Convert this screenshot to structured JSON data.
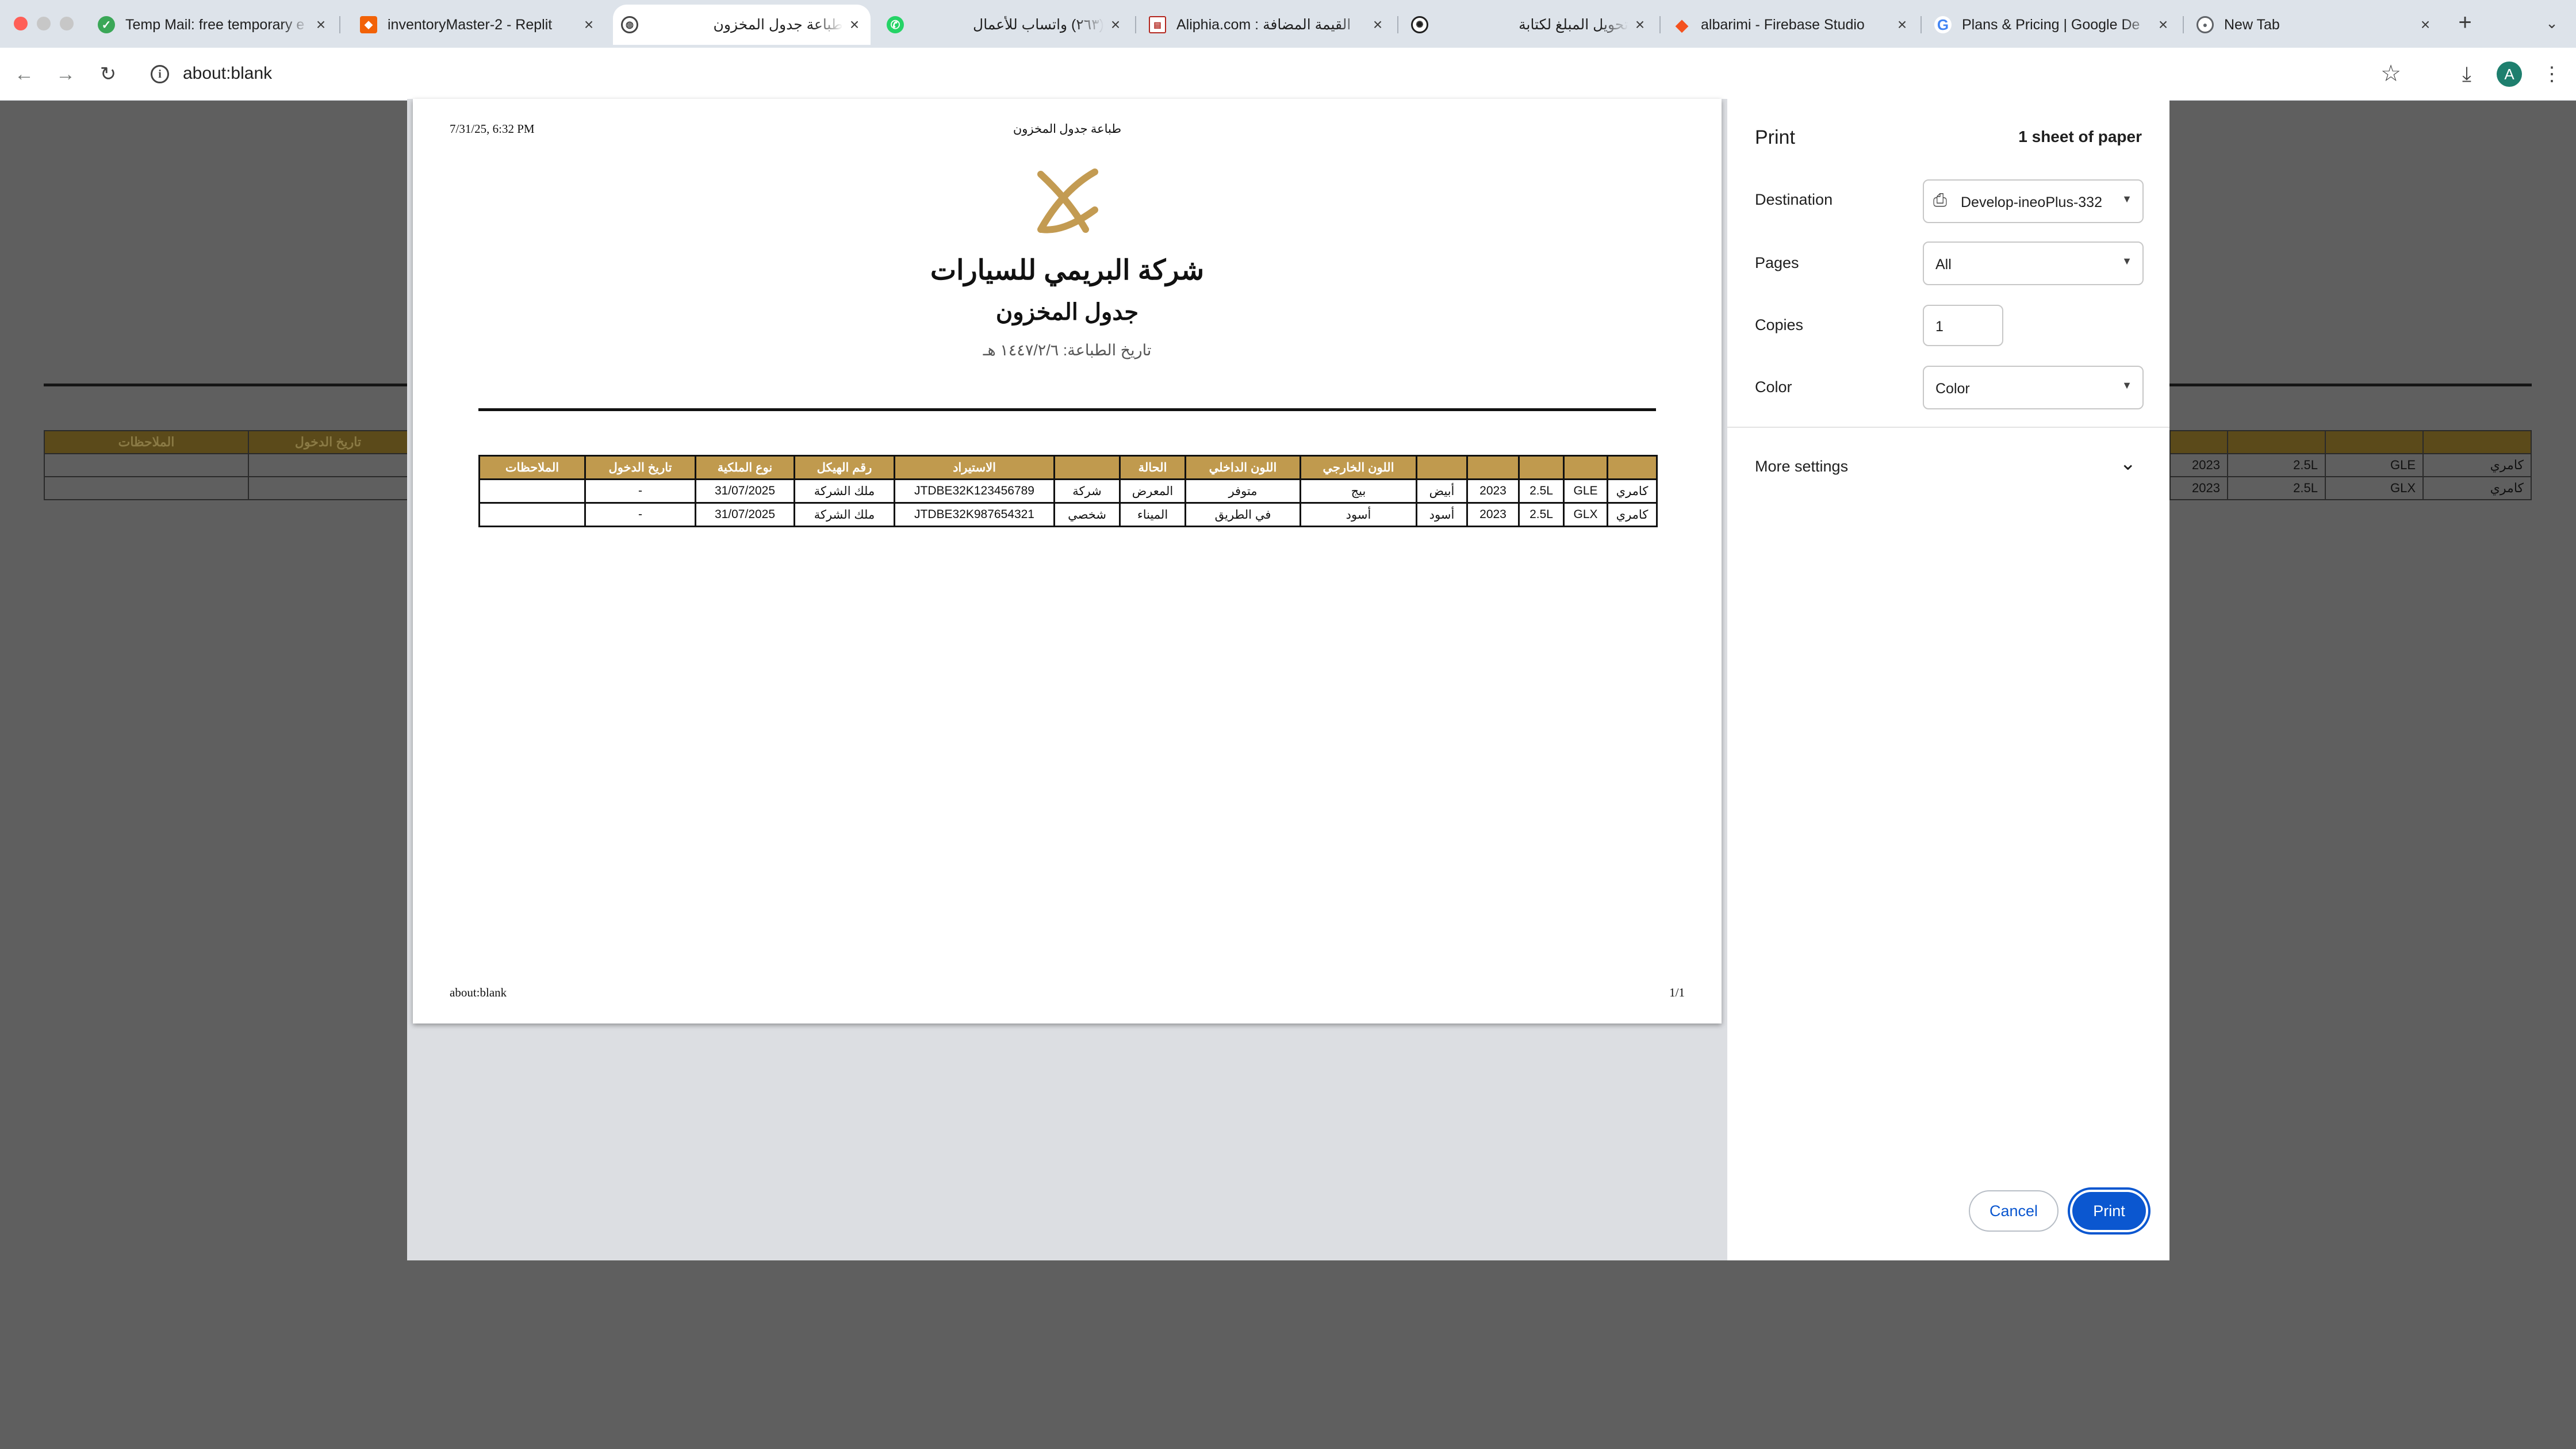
{
  "browser": {
    "tabs": [
      {
        "title": "Temp Mail: free temporary e",
        "favicon": "shield-check-icon",
        "color": "#3aa757",
        "active": false,
        "rtl": false
      },
      {
        "title": "inventoryMaster-2 - Replit",
        "favicon": "replit-icon",
        "color": "#f26207",
        "active": false,
        "rtl": false
      },
      {
        "title": "طباعة جدول المخزون",
        "favicon": "globe-icon",
        "color": "#5f6368",
        "active": true,
        "rtl": true
      },
      {
        "title": "(٢٦٣) واتساب للأعمال",
        "favicon": "whatsapp-icon",
        "color": "#25d366",
        "active": false,
        "rtl": true
      },
      {
        "title": "Aliphia.com : القيمة المضافة",
        "favicon": "document-icon",
        "color": "#b3261e",
        "active": false,
        "rtl": false
      },
      {
        "title": "تحويل المبلغ لكتابة",
        "favicon": "openai-icon",
        "color": "#1f1f1f",
        "active": false,
        "rtl": true
      },
      {
        "title": "albarimi - Firebase Studio",
        "favicon": "firebase-icon",
        "color": "#f4511e",
        "active": false,
        "rtl": false
      },
      {
        "title": "Plans & Pricing | Google De",
        "favicon": "google-icon",
        "color": "#4285f4",
        "active": false,
        "rtl": false
      },
      {
        "title": "New Tab",
        "favicon": "chrome-icon",
        "color": "#5f6368",
        "active": false,
        "rtl": false
      }
    ],
    "new_tab": "+",
    "url": "about:blank",
    "avatar_letter": "A"
  },
  "background_page": {
    "left_headers": [
      "تاريخ الدخول",
      "الملاحظات"
    ],
    "right_rows": [
      [
        "2023",
        "2.5L",
        "GLE",
        "كامري"
      ],
      [
        "2023",
        "2.5L",
        "GLX",
        "كامري"
      ]
    ]
  },
  "print_preview": {
    "header_date": "7/31/25, 6:32 PM",
    "header_title": "طباعة جدول المخزون",
    "company_name": "شركة البريمي للسيارات",
    "report_title": "جدول المخزون",
    "print_date": "تاريخ الطباعة: ١٤٤٧/٢/٦ هـ",
    "footer_url": "about:blank",
    "footer_page": "1/1",
    "brand_color": "#c09a4e",
    "table": {
      "headers": [
        "",
        "",
        "",
        "",
        "",
        "اللون الخارجي",
        "اللون الداخلي",
        "الحالة",
        "",
        "الاستيراد",
        "رقم الهيكل",
        "نوع الملكية",
        "تاريخ الدخول",
        "الملاحظات"
      ],
      "rows": [
        [
          "كامري",
          "GLE",
          "2.5L",
          "2023",
          "أبيض",
          "بيج",
          "متوفر",
          "المعرض",
          "شركة",
          "JTDBE32K123456789",
          "ملك الشركة",
          "31/07/2025",
          "-",
          ""
        ],
        [
          "كامري",
          "GLX",
          "2.5L",
          "2023",
          "أسود",
          "أسود",
          "في الطريق",
          "الميناء",
          "شخصي",
          "JTDBE32K987654321",
          "ملك الشركة",
          "31/07/2025",
          "-",
          ""
        ]
      ]
    }
  },
  "print_settings": {
    "heading": "Print",
    "sheets": "1 sheet of paper",
    "destination_label": "Destination",
    "destination_value": "Develop-ineoPlus-332",
    "pages_label": "Pages",
    "pages_value": "All",
    "copies_label": "Copies",
    "copies_value": "1",
    "color_label": "Color",
    "color_value": "Color",
    "more_settings": "More settings",
    "cancel": "Cancel",
    "print": "Print",
    "accent_color": "#0b57d0"
  }
}
